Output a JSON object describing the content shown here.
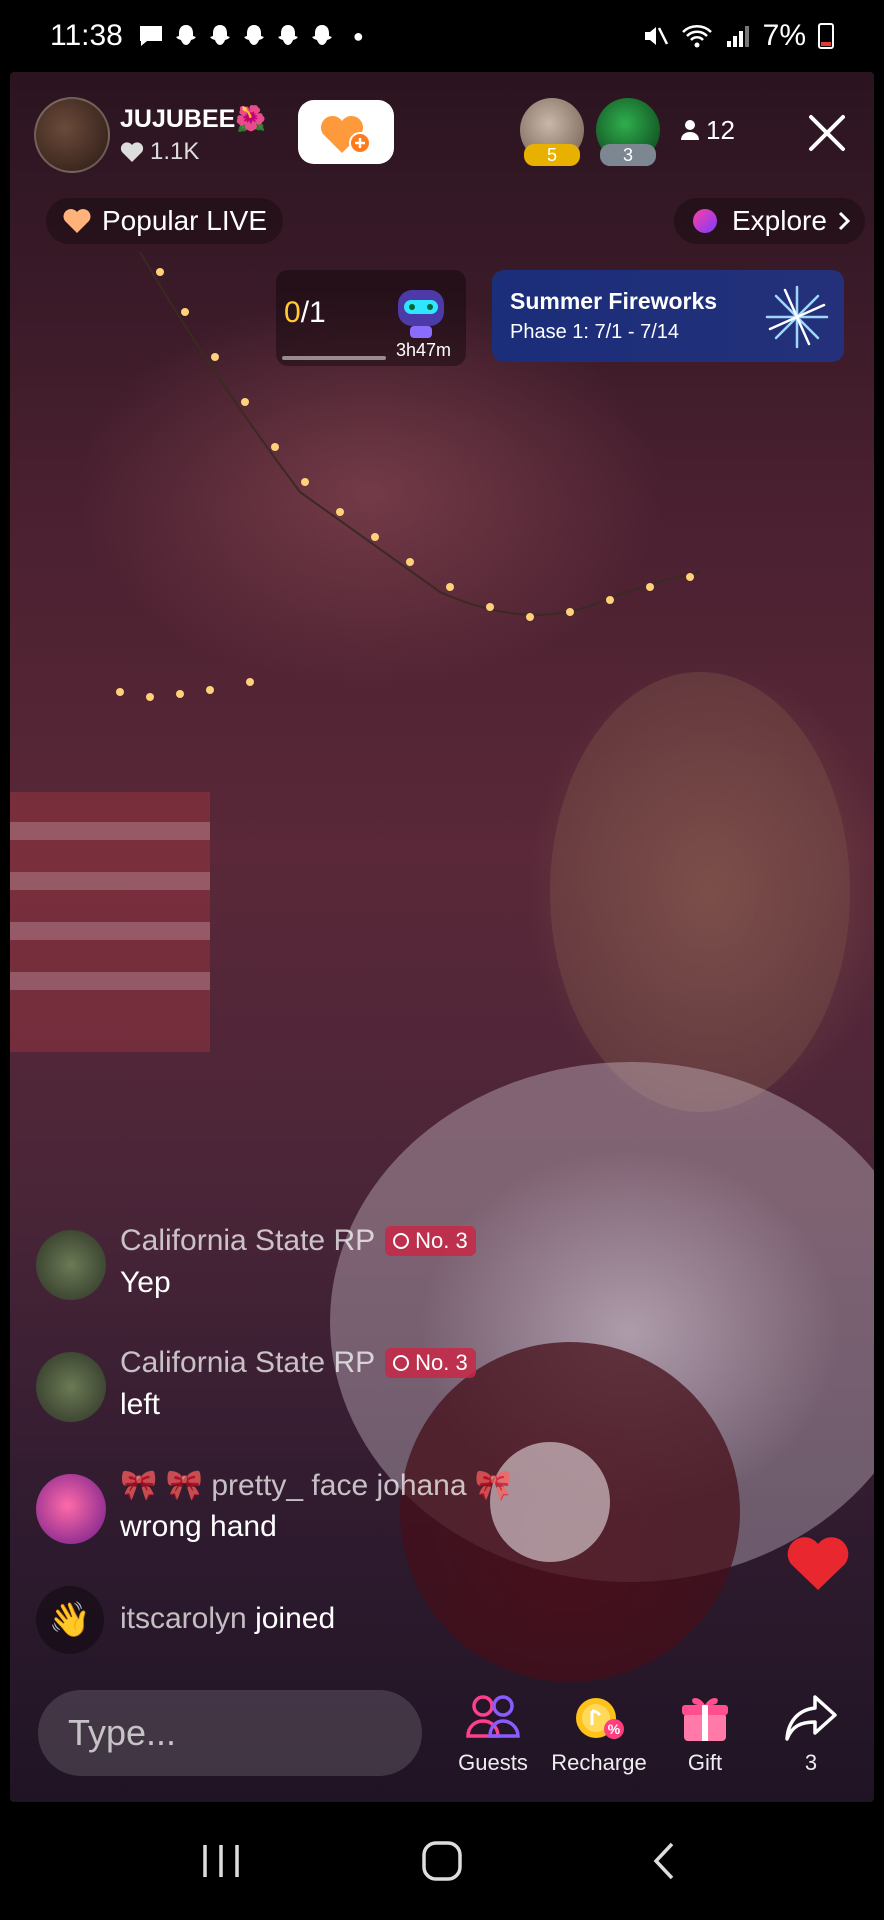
{
  "status_bar": {
    "time": "11:38",
    "battery": "7%",
    "notification_icons": [
      "chat-icon",
      "snapchat-icon",
      "snapchat-icon",
      "snapchat-icon",
      "snapchat-icon",
      "snapchat-icon"
    ]
  },
  "host": {
    "name": "JUJUBEE",
    "name_emoji": "🌺",
    "likes": "1.1K"
  },
  "viewers": {
    "badge1_rank": "5",
    "badge2_rank": "3",
    "count": "12"
  },
  "nav": {
    "popular_label": "Popular LIVE",
    "explore_label": "Explore"
  },
  "quest": {
    "done": "0",
    "total": "/1",
    "timer": "3h47m"
  },
  "event": {
    "title": "Summer Fireworks",
    "subtitle": "Phase 1: 7/1 - 7/14"
  },
  "comments": [
    {
      "user": "California State RP",
      "rank": "No. 3",
      "text": "Yep"
    },
    {
      "user": "California State RP",
      "rank": "No. 3",
      "text": "left"
    },
    {
      "user": "🎀 🎀 pretty_ face johana 🎀",
      "text": "wrong hand"
    }
  ],
  "joined": {
    "user": "itscarolyn",
    "text": "joined"
  },
  "input": {
    "placeholder": "Type..."
  },
  "actions": [
    {
      "label": "Guests"
    },
    {
      "label": "Recharge"
    },
    {
      "label": "Gift"
    },
    {
      "label": "3"
    }
  ],
  "colors": {
    "accent_pink": "#fe2c55",
    "follow_orange": "#ff9a3c",
    "event_blue": "#1b2e7a",
    "quest_yellow": "#ffcc33"
  }
}
